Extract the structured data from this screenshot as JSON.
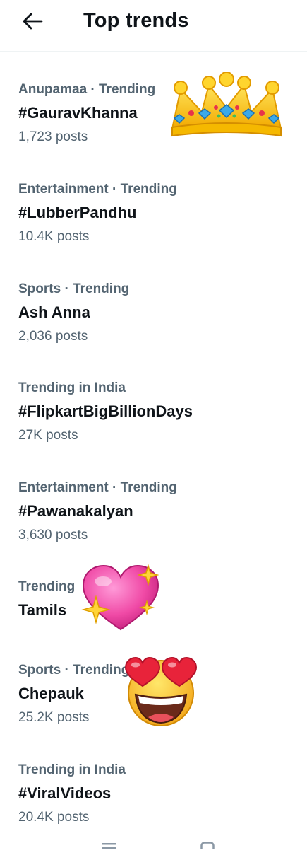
{
  "header": {
    "title": "Top trends"
  },
  "trends": [
    {
      "meta": "Anupamaa · Trending",
      "name": "#GauravKhanna",
      "count": "1,723 posts"
    },
    {
      "meta": "Entertainment · Trending",
      "name": "#LubberPandhu",
      "count": "10.4K posts"
    },
    {
      "meta": "Sports · Trending",
      "name": "Ash Anna",
      "count": "2,036 posts"
    },
    {
      "meta": "Trending in India",
      "name": "#FlipkartBigBillionDays",
      "count": "27K posts"
    },
    {
      "meta": "Entertainment · Trending",
      "name": "#Pawanakalyan",
      "count": "3,630 posts"
    },
    {
      "meta": "Trending",
      "name": "Tamils"
    },
    {
      "meta": "Sports · Trending",
      "name": "Chepauk",
      "count": "25.2K posts"
    },
    {
      "meta": "Trending in India",
      "name": "#ViralVideos",
      "count": "20.4K posts"
    }
  ],
  "stickers": [
    "crown-emoji",
    "sparkling-heart-emoji",
    "heart-eyes-emoji"
  ],
  "colors": {
    "primary_text": "#0f1419",
    "secondary_text": "#536471",
    "divider": "#eff3f4"
  }
}
